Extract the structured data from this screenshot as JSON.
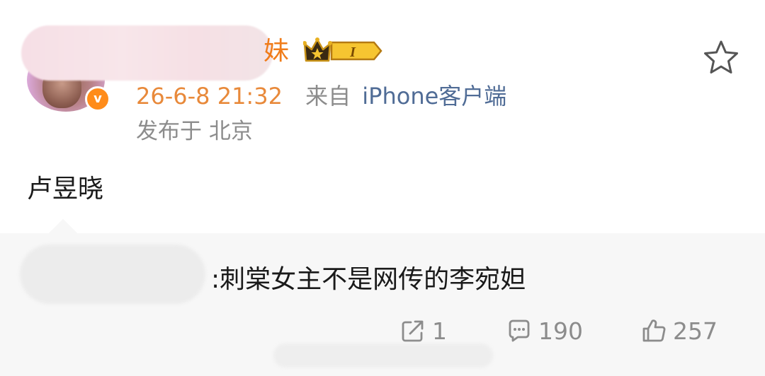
{
  "post": {
    "author_name_visible_tail": "妹",
    "badge_level": "I",
    "timestamp": "26-6-8 21:32",
    "source_prefix": "来自",
    "source_device": "iPhone客户端",
    "location": "发布于 北京",
    "text": "卢昱晓",
    "favorite_icon": "star-outline-icon",
    "verified_icon": "verified-v-icon"
  },
  "repost": {
    "text": ":刺棠女主不是网传的李宛妲"
  },
  "actions": {
    "repost_count": "1",
    "comment_count": "190",
    "like_count": "257",
    "repost_icon": "share-icon",
    "comment_icon": "comment-icon",
    "like_icon": "thumbs-up-icon"
  },
  "colors": {
    "time": "#e8893a",
    "name_accent": "#f07c1a",
    "device_link": "#506c96",
    "muted": "#8c8c8c",
    "repost_bg": "#f7f7f7"
  }
}
